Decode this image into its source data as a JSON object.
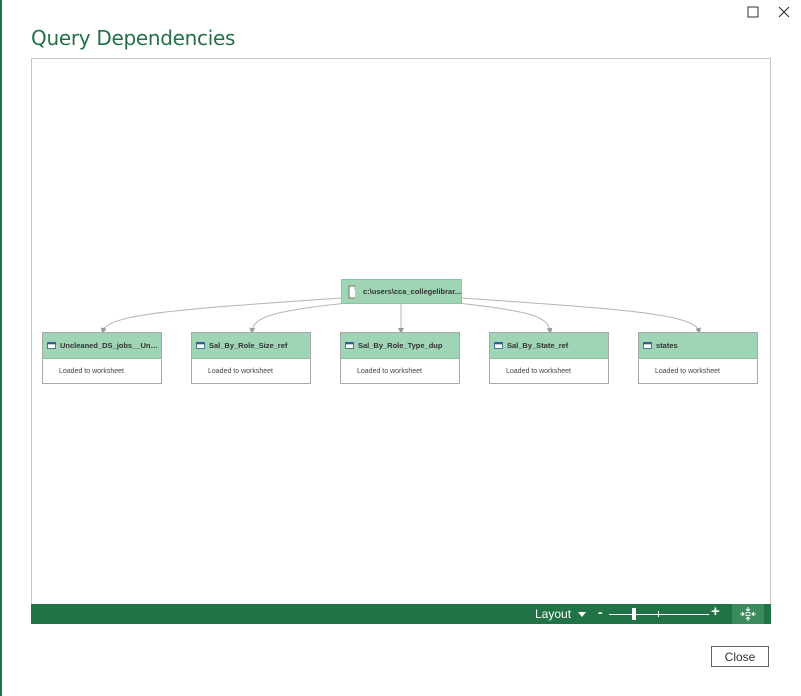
{
  "window": {
    "title": "Query Dependencies",
    "maximize_icon": "maximize-icon",
    "close_icon": "close-icon"
  },
  "graph": {
    "source": {
      "label": "c:\\users\\cca_collegelibrar...",
      "icon": "file-icon"
    },
    "queries": [
      {
        "label": "Uncleaned_DS_jobs__Uncle...",
        "status": "Loaded to worksheet",
        "icon": "table-icon"
      },
      {
        "label": "Sal_By_Role_Size_ref",
        "status": "Loaded to worksheet",
        "icon": "table-icon"
      },
      {
        "label": "Sal_By_Role_Type_dup",
        "status": "Loaded to worksheet",
        "icon": "table-icon"
      },
      {
        "label": "Sal_By_State_ref",
        "status": "Loaded to worksheet",
        "icon": "table-icon"
      },
      {
        "label": "states",
        "status": "Loaded to worksheet",
        "icon": "table-icon"
      }
    ]
  },
  "toolbar": {
    "layout_label": "Layout",
    "zoom_minus": "-",
    "zoom_plus": "+",
    "zoom_level": 0.25,
    "fit_icon": "fit-to-screen-icon"
  },
  "footer": {
    "close_label": "Close"
  },
  "colors": {
    "accent": "#217346",
    "node_header": "#9fd4b5"
  }
}
